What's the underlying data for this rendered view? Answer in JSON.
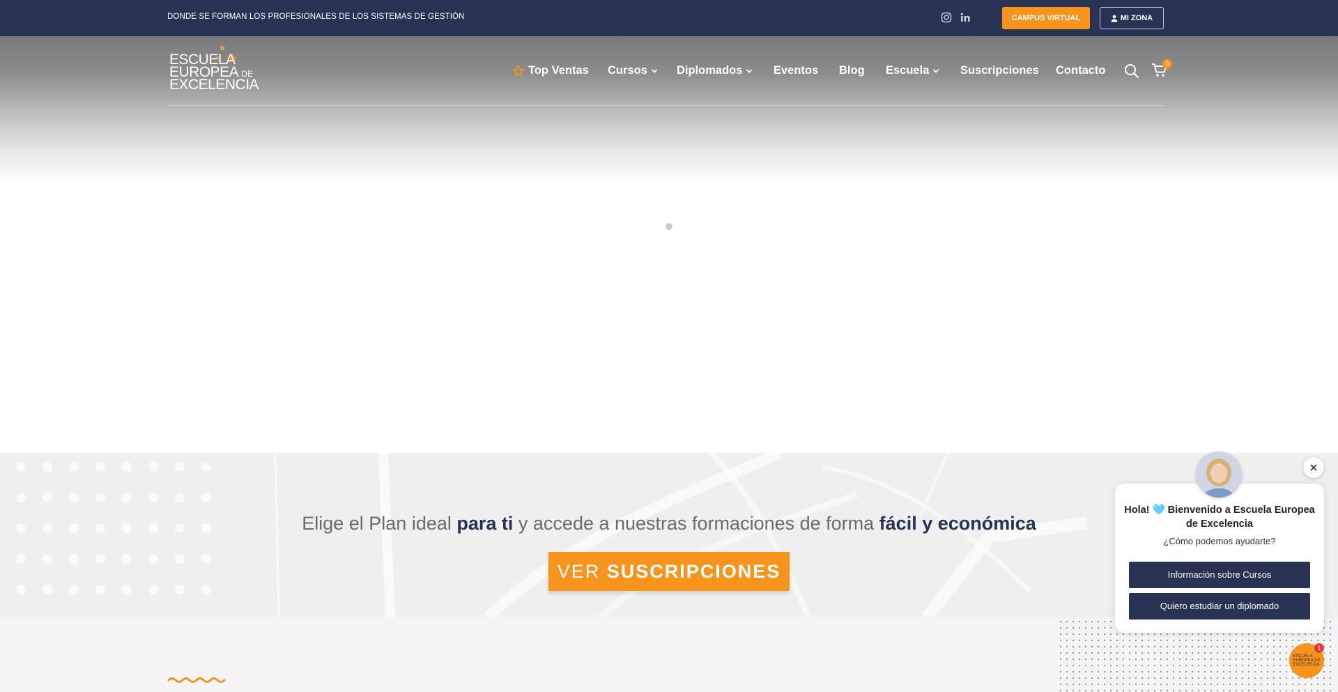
{
  "topbar": {
    "tagline": "DONDE SE FORMAN LOS PROFESIONALES DE LOS SISTEMAS DE GESTIÓN",
    "social_icons": [
      "instagram-icon",
      "linkedin-icon"
    ],
    "campus_label": "CAMPUS VIRTUAL",
    "mizona_label": "MI ZONA"
  },
  "logo": {
    "line1": "ESCUELA",
    "line2": "EUROPEA",
    "line2_suffix": "DE",
    "line3": "EXCELENCIA"
  },
  "nav": {
    "items": [
      {
        "label": "Top Ventas",
        "icon": "star-icon"
      },
      {
        "label": "Cursos",
        "dropdown": true
      },
      {
        "label": "Diplomados",
        "dropdown": true
      },
      {
        "label": "Eventos"
      },
      {
        "label": "Blog"
      },
      {
        "label": "Escuela",
        "dropdown": true
      },
      {
        "label": "Suscripciones"
      },
      {
        "label": "Contacto"
      }
    ],
    "cart_count": "0"
  },
  "banner": {
    "headline_1": "Elige el Plan ideal ",
    "headline_2": "para ti",
    "headline_3": " y accede a nuestras formaciones de forma ",
    "headline_4": "fácil y económica",
    "button_light": "VER ",
    "button_strong": "SUSCRIPCIONES"
  },
  "chat": {
    "title": "Hola! 🩵 Bienvenido a Escuela Europea de Excelencia",
    "subtitle": "¿Cómo podemos ayudarte?",
    "option_1": "Información sobre Cursos",
    "option_2": "Quiero estudiar un diplomado",
    "badge_count": "1"
  },
  "colors": {
    "navy": "#283252",
    "orange": "#f7941d"
  }
}
